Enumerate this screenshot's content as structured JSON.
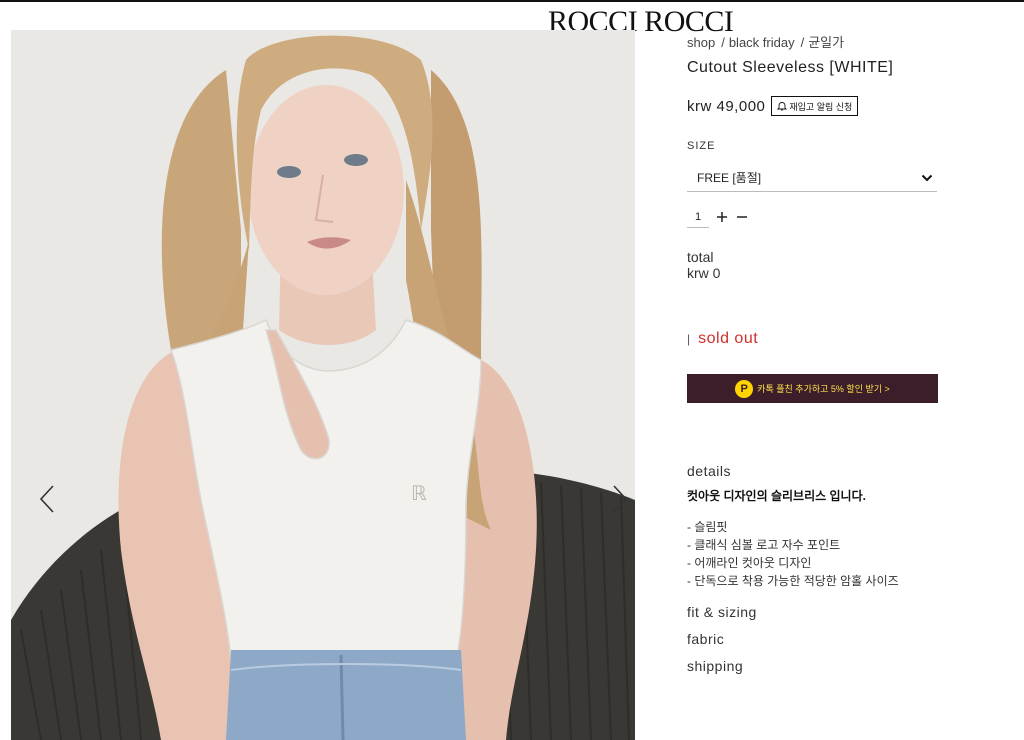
{
  "brand": {
    "logo_text": "ROCCI ROCCI"
  },
  "breadcrumb": {
    "items": [
      "shop",
      "black friday",
      "균일가"
    ],
    "separator": "/"
  },
  "product": {
    "title": "Cutout Sleeveless [WHITE]",
    "price": "krw 49,000",
    "restock_button": "재입고 알림 신청",
    "size_label": "SIZE",
    "size_selected": "FREE [품절]",
    "quantity": "1",
    "total_label": "total",
    "total_value": "krw 0",
    "status_bar": "|",
    "status": "sold out",
    "status_color": "#d0302a"
  },
  "kakao_banner": {
    "badge": "P",
    "text": "카톡 플친 추가하고 5% 할인 받기 >",
    "bg_color": "#3b1e2a",
    "text_color": "#ffe14d"
  },
  "details": {
    "heading": "details",
    "lead": "컷아웃 디자인의 슬리브리스 입니다.",
    "bullets": [
      "- 슬림핏",
      "- 클래식 심볼 로고 자수 포인트",
      "- 어깨라인 컷아웃 디자인",
      "- 단독으로 착용 가능한 적당한 암홀 사이즈"
    ]
  },
  "accordions": {
    "fit": "fit & sizing",
    "fabric": "fabric",
    "shipping": "shipping"
  },
  "gallery": {
    "prev_icon": "chevron-left-icon",
    "next_icon": "chevron-right-icon"
  }
}
